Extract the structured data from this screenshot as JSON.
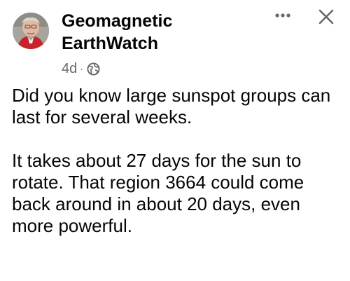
{
  "post": {
    "author": "Geomagnetic EarthWatch",
    "time": "4d",
    "separator": "·",
    "privacy_icon": "globe-icon",
    "paragraphs": [
      "Did you know large sunspot groups can last for several weeks.",
      "It takes about 27 days for the sun to rotate. That region 3664 could come back around in about 20 days, even more powerful."
    ]
  },
  "actions": {
    "more_icon": "more-options-icon",
    "close_icon": "close-icon"
  },
  "colors": {
    "text_primary": "#050505",
    "text_secondary": "#65676b",
    "background": "#ffffff"
  }
}
